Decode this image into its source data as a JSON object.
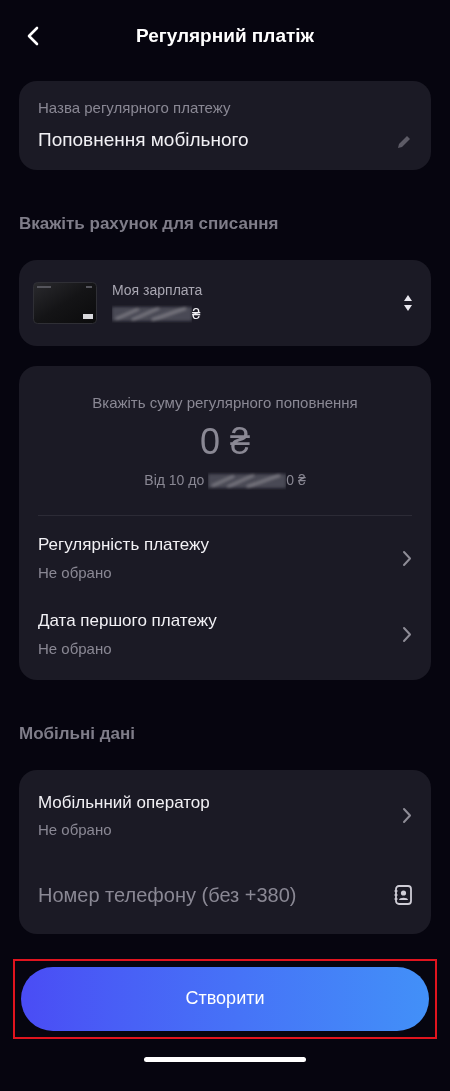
{
  "header": {
    "title": "Регулярний платіж"
  },
  "name_field": {
    "label": "Назва регулярного платежу",
    "value": "Поповнення мобільного"
  },
  "account_section": {
    "title": "Вкажіть рахунок для списання"
  },
  "account": {
    "name": "Моя зарплата",
    "currency": "₴"
  },
  "amount": {
    "prompt": "Вкажіть суму регулярного поповнення",
    "value": "0 ₴",
    "range_from": "Від 10 до",
    "range_to_end": "0 ₴"
  },
  "schedule_rows": [
    {
      "title": "Регулярність платежу",
      "value": "Не обрано"
    },
    {
      "title": "Дата першого платежу",
      "value": "Не обрано"
    }
  ],
  "mobile_section": {
    "title": "Мобільні дані"
  },
  "operator_row": {
    "title": "Мобільнний оператор",
    "value": "Не обрано"
  },
  "phone_field": {
    "placeholder": "Номер телефону (без +380)"
  },
  "create_button": {
    "label": "Створити",
    "highlighted": true
  }
}
